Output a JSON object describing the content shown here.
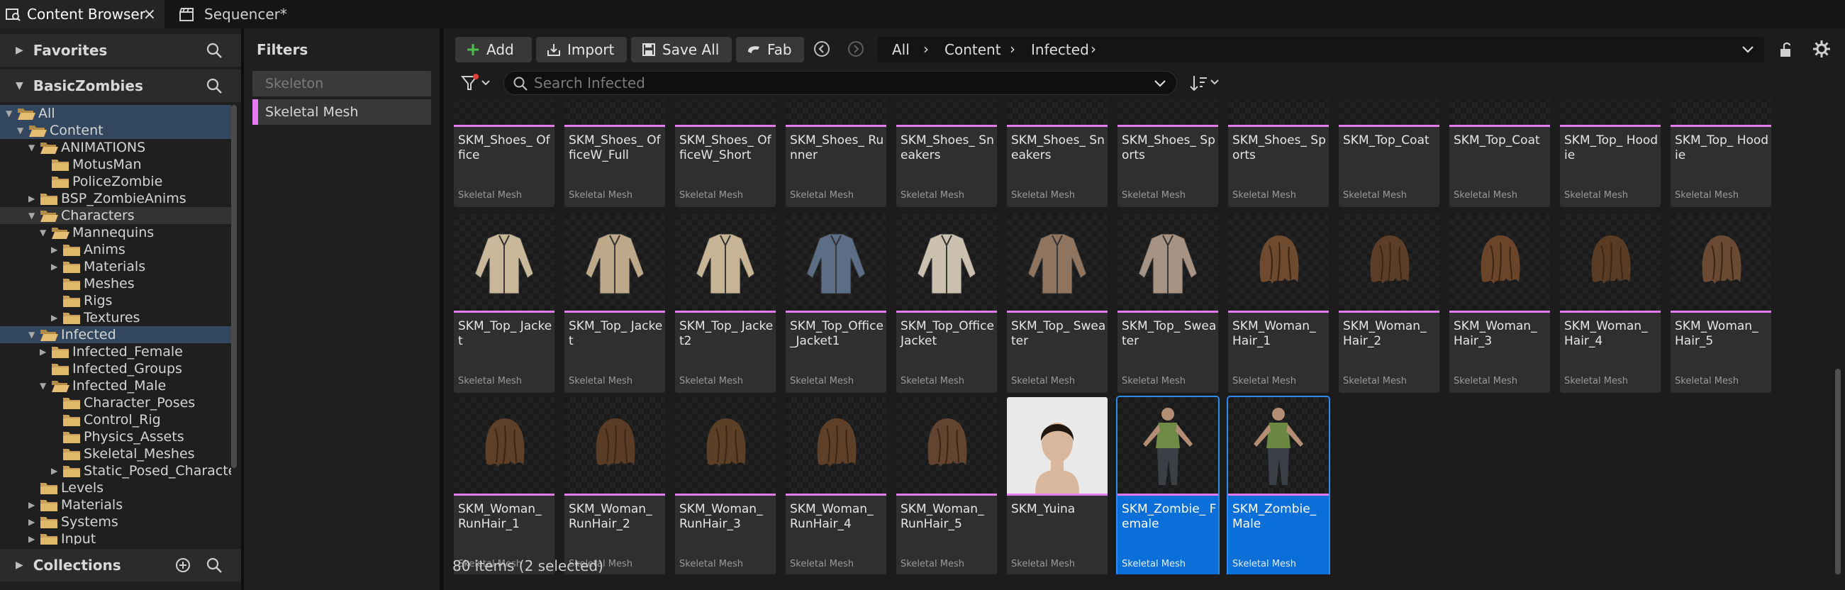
{
  "tabs": [
    {
      "label": "Content Browser",
      "close": "×"
    },
    {
      "label": "Sequencer*"
    }
  ],
  "left": {
    "favorites": "Favorites",
    "project": "BasicZombies",
    "collections": "Collections",
    "tree": [
      {
        "label": "All",
        "depth": 0,
        "expanded": true,
        "sel": "blue2"
      },
      {
        "label": "Content",
        "depth": 1,
        "expanded": true,
        "sel": "blue2"
      },
      {
        "label": "ANIMATIONS",
        "depth": 2,
        "expanded": true
      },
      {
        "label": "MotusMan",
        "depth": 3
      },
      {
        "label": "PoliceZombie",
        "depth": 3
      },
      {
        "label": "BSP_ZombieAnims",
        "depth": 2,
        "collapsed": true
      },
      {
        "label": "Characters",
        "depth": 2,
        "expanded": true,
        "sel": "dark"
      },
      {
        "label": "Mannequins",
        "depth": 3,
        "expanded": true
      },
      {
        "label": "Anims",
        "depth": 4,
        "collapsed": true
      },
      {
        "label": "Materials",
        "depth": 4,
        "collapsed": true
      },
      {
        "label": "Meshes",
        "depth": 4
      },
      {
        "label": "Rigs",
        "depth": 4
      },
      {
        "label": "Textures",
        "depth": 4,
        "collapsed": true
      },
      {
        "label": "Infected",
        "depth": 2,
        "expanded": true,
        "sel": "blue"
      },
      {
        "label": "Infected_Female",
        "depth": 3,
        "collapsed": true
      },
      {
        "label": "Infected_Groups",
        "depth": 3
      },
      {
        "label": "Infected_Male",
        "depth": 3,
        "expanded": true
      },
      {
        "label": "Character_Poses",
        "depth": 4
      },
      {
        "label": "Control_Rig",
        "depth": 4
      },
      {
        "label": "Physics_Assets",
        "depth": 4
      },
      {
        "label": "Skeletal_Meshes",
        "depth": 4
      },
      {
        "label": "Static_Posed_Characters",
        "depth": 4,
        "collapsed": true
      },
      {
        "label": "Levels",
        "depth": 2
      },
      {
        "label": "Materials",
        "depth": 2,
        "collapsed": true
      },
      {
        "label": "Systems",
        "depth": 2,
        "collapsed": true
      },
      {
        "label": "Input",
        "depth": 2,
        "collapsed": true
      }
    ]
  },
  "filters": {
    "title": "Filters",
    "items": [
      "Skeleton",
      "Skeletal Mesh"
    ]
  },
  "toolbar": {
    "add": "Add",
    "import": "Import",
    "save_all": "Save All",
    "fab": "Fab",
    "crumbs": [
      "All",
      "Content",
      "Infected"
    ]
  },
  "search": {
    "placeholder": "Search Infected"
  },
  "assets": [
    {
      "name": "SKM_Shoes_ Office",
      "type": "Skeletal Mesh",
      "row": 0
    },
    {
      "name": "SKM_Shoes_ OfficeW_Full",
      "type": "Skeletal Mesh",
      "row": 0
    },
    {
      "name": "SKM_Shoes_ OfficeW_Short",
      "type": "Skeletal Mesh",
      "row": 0
    },
    {
      "name": "SKM_Shoes_ Runner",
      "type": "Skeletal Mesh",
      "row": 0
    },
    {
      "name": "SKM_Shoes_ Sneakers",
      "type": "Skeletal Mesh",
      "row": 0
    },
    {
      "name": "SKM_Shoes_ Sneakers",
      "type": "Skeletal Mesh",
      "row": 0
    },
    {
      "name": "SKM_Shoes_ Sports",
      "type": "Skeletal Mesh",
      "row": 0
    },
    {
      "name": "SKM_Shoes_ Sports",
      "type": "Skeletal Mesh",
      "row": 0
    },
    {
      "name": "SKM_Top_Coat",
      "type": "Skeletal Mesh",
      "row": 0
    },
    {
      "name": "SKM_Top_Coat",
      "type": "Skeletal Mesh",
      "row": 0
    },
    {
      "name": "SKM_Top_ Hoodie",
      "type": "Skeletal Mesh",
      "row": 0
    },
    {
      "name": "SKM_Top_ Hoodie",
      "type": "Skeletal Mesh",
      "row": 0
    },
    {
      "name": "SKM_Top_ Jacket",
      "type": "Skeletal Mesh",
      "row": 1,
      "thumb": "jacket",
      "color": "#c9b79a"
    },
    {
      "name": "SKM_Top_ Jacket",
      "type": "Skeletal Mesh",
      "row": 1,
      "thumb": "jacket",
      "color": "#bda98a"
    },
    {
      "name": "SKM_Top_ Jacket2",
      "type": "Skeletal Mesh",
      "row": 1,
      "thumb": "jacket",
      "color": "#c6b495"
    },
    {
      "name": "SKM_Top_Office _Jacket1",
      "type": "Skeletal Mesh",
      "row": 1,
      "thumb": "jacket",
      "color": "#5b6e85"
    },
    {
      "name": "SKM_Top_Office Jacket",
      "type": "Skeletal Mesh",
      "row": 1,
      "thumb": "jacket",
      "color": "#cbbfae"
    },
    {
      "name": "SKM_Top_ Sweater",
      "type": "Skeletal Mesh",
      "row": 1,
      "thumb": "jacket",
      "color": "#8f7560"
    },
    {
      "name": "SKM_Top_ Sweater",
      "type": "Skeletal Mesh",
      "row": 1,
      "thumb": "jacket",
      "color": "#a79383"
    },
    {
      "name": "SKM_Woman_ Hair_1",
      "type": "Skeletal Mesh",
      "row": 1,
      "thumb": "hair",
      "color": "#6e4a2e"
    },
    {
      "name": "SKM_Woman_ Hair_2",
      "type": "Skeletal Mesh",
      "row": 1,
      "thumb": "hair",
      "color": "#5c3e28"
    },
    {
      "name": "SKM_Woman_ Hair_3",
      "type": "Skeletal Mesh",
      "row": 1,
      "thumb": "hair",
      "color": "#6a4529"
    },
    {
      "name": "SKM_Woman_ Hair_4",
      "type": "Skeletal Mesh",
      "row": 1,
      "thumb": "hair",
      "color": "#5a3b24"
    },
    {
      "name": "SKM_Woman_ Hair_5",
      "type": "Skeletal Mesh",
      "row": 1,
      "thumb": "hair",
      "color": "#6b4a33"
    },
    {
      "name": "SKM_Woman_ RunHair_1",
      "type": "Skeletal Mesh",
      "row": 2,
      "thumb": "hair",
      "color": "#5e4028"
    },
    {
      "name": "SKM_Woman_ RunHair_2",
      "type": "Skeletal Mesh",
      "row": 2,
      "thumb": "hair",
      "color": "#5a3c26"
    },
    {
      "name": "SKM_Woman_ RunHair_3",
      "type": "Skeletal Mesh",
      "row": 2,
      "thumb": "hair",
      "color": "#5c3f27"
    },
    {
      "name": "SKM_Woman_ RunHair_4",
      "type": "Skeletal Mesh",
      "row": 2,
      "thumb": "hair",
      "color": "#5e4029"
    },
    {
      "name": "SKM_Woman_ RunHair_5",
      "type": "Skeletal Mesh",
      "row": 2,
      "thumb": "hair",
      "color": "#634430"
    },
    {
      "name": "SKM_Yuina",
      "type": "Skeletal Mesh",
      "row": 2,
      "thumb": "head",
      "color": "#d8b79c"
    },
    {
      "name": "SKM_Zombie_ Female",
      "type": "Skeletal Mesh",
      "row": 2,
      "thumb": "figure",
      "color": "#6f8a45",
      "selected": true
    },
    {
      "name": "SKM_Zombie_ Male",
      "type": "Skeletal Mesh",
      "row": 2,
      "thumb": "figure",
      "color": "#6a8842",
      "selected": true
    }
  ],
  "status": "80 items (2 selected)",
  "colors": {
    "accent": "#0a6fd8",
    "skeletal_mesh": "#e27cf0",
    "tree_selected": "#32465e"
  }
}
